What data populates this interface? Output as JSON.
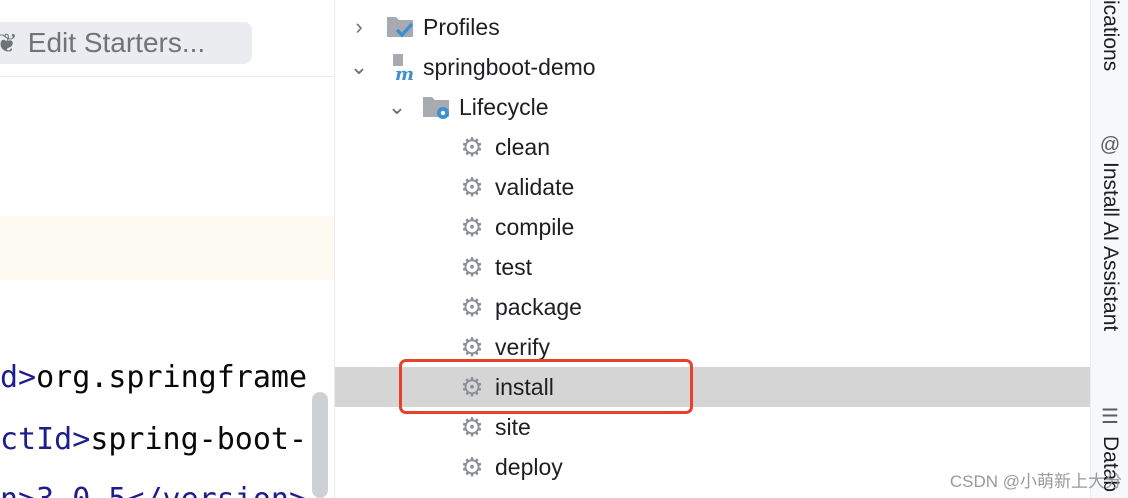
{
  "editor": {
    "starters_button": "Edit Starters...",
    "code_lines": [
      {
        "prefix": "d>",
        "text": "org.springframe"
      },
      {
        "prefix": "ctId>",
        "text": "spring-boot-"
      },
      {
        "prefix": "n>3.0.5</version>",
        "text": ""
      }
    ]
  },
  "maven": {
    "profiles": "Profiles",
    "project": "springboot-demo",
    "lifecycle": "Lifecycle",
    "phases": [
      "clean",
      "validate",
      "compile",
      "test",
      "package",
      "verify",
      "install",
      "site",
      "deploy"
    ],
    "selected_phase": "install"
  },
  "right_strip": {
    "notifications_label": "ications",
    "ai_label": "Install AI Assistant",
    "database_label": "Datab"
  },
  "watermark": "CSDN @小萌新上大分",
  "colors": {
    "selection": "#d5d5d5",
    "highlight_border": "#e8412a",
    "maven_blue": "#3d8fd1"
  }
}
